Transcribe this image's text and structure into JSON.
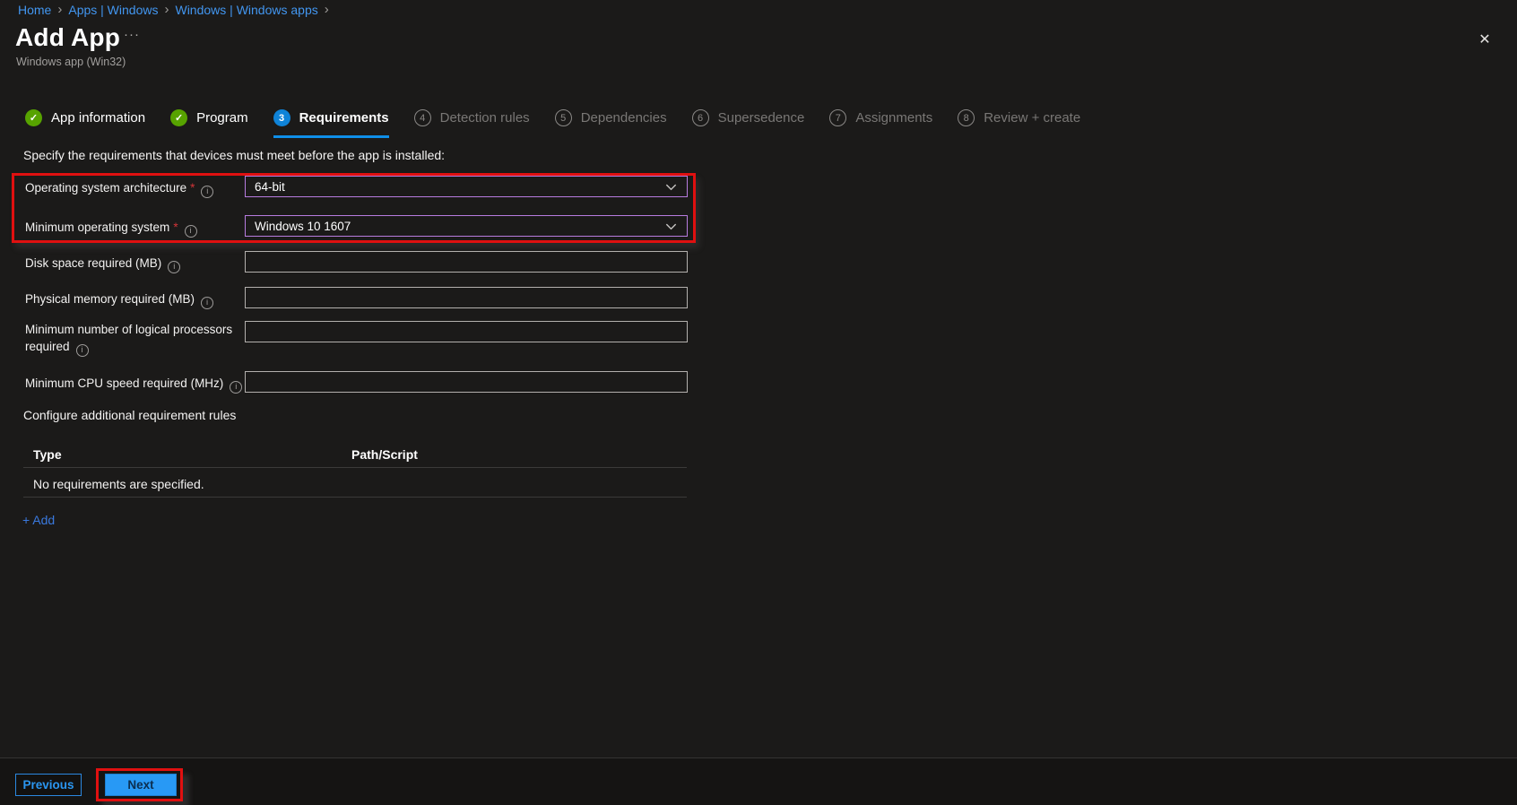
{
  "breadcrumb": {
    "items": [
      "Home",
      "Apps | Windows",
      "Windows | Windows apps"
    ],
    "separator": "›"
  },
  "header": {
    "title": "Add App",
    "menu_dots": "···",
    "subtitle": "Windows app (Win32)",
    "close_glyph": "✕"
  },
  "steps": [
    {
      "label": "App information",
      "glyph": "✓"
    },
    {
      "label": "Program",
      "glyph": "✓"
    },
    {
      "label": "Requirements",
      "number": "3"
    },
    {
      "label": "Detection rules",
      "number": "4"
    },
    {
      "label": "Dependencies",
      "number": "5"
    },
    {
      "label": "Supersedence",
      "number": "6"
    },
    {
      "label": "Assignments",
      "number": "7"
    },
    {
      "label": "Review + create",
      "number": "8"
    }
  ],
  "intro": "Specify the requirements that devices must meet before the app is installed:",
  "form": {
    "required_marker": "*",
    "info_glyph": "i",
    "rows": [
      {
        "label": "Operating system architecture",
        "value": "64-bit",
        "required": true
      },
      {
        "label": "Minimum operating system",
        "value": "Windows 10 1607",
        "required": true
      },
      {
        "label": "Disk space required (MB)",
        "value": "",
        "required": false
      },
      {
        "label": "Physical memory required (MB)",
        "value": "",
        "required": false
      },
      {
        "label": "Minimum number of logical processors required",
        "value": "",
        "required": false
      },
      {
        "label": "Minimum CPU speed required (MHz)",
        "value": "",
        "required": false
      }
    ]
  },
  "additional_rules": {
    "heading": "Configure additional requirement rules",
    "columns": [
      "Type",
      "Path/Script"
    ],
    "empty_message": "No requirements are specified.",
    "add_label": "+ Add"
  },
  "footer": {
    "previous": "Previous",
    "next": "Next"
  },
  "colors": {
    "background": "#1b1a19",
    "link_blue": "#4296f0",
    "active_step_blue": "#0f83d8",
    "step_done_green": "#57a300",
    "select_border_purple": "#b87ce0",
    "annotation_red": "#e01010",
    "next_button_bg": "#2899f5",
    "pending_gray": "#797775"
  }
}
